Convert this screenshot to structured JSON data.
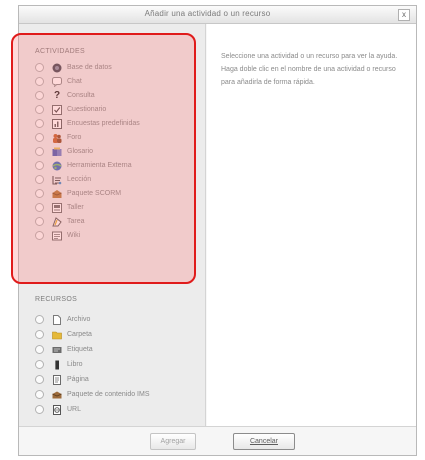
{
  "window": {
    "title": "Añadir una actividad o un recurso",
    "close": "x"
  },
  "help_text": "Seleccione una actividad o un recurso para ver la ayuda. Haga doble clic en el nombre de una actividad o recurso para añadirla de forma rápida.",
  "activities": {
    "heading": "ACTIVIDADES",
    "items": [
      {
        "label": "Base de datos",
        "icon": "database-icon",
        "color": "#444a55"
      },
      {
        "label": "Chat",
        "icon": "chat-icon",
        "color": "#8c8c8c"
      },
      {
        "label": "Consulta",
        "icon": "question-icon",
        "color": "#222222"
      },
      {
        "label": "Cuestionario",
        "icon": "quiz-icon",
        "color": "#6b6b6b"
      },
      {
        "label": "Encuestas predefinidas",
        "icon": "survey-icon",
        "color": "#5f5f5f"
      },
      {
        "label": "Foro",
        "icon": "forum-icon",
        "color": "#c2622d"
      },
      {
        "label": "Glosario",
        "icon": "glossary-icon",
        "color": "#4a5db6"
      },
      {
        "label": "Herramienta Externa",
        "icon": "external-tool-icon",
        "color": "#3b6cc1"
      },
      {
        "label": "Lección",
        "icon": "lesson-icon",
        "color": "#555555"
      },
      {
        "label": "Paquete SCORM",
        "icon": "scorm-icon",
        "color": "#b5793b"
      },
      {
        "label": "Taller",
        "icon": "workshop-icon",
        "color": "#6f6f6f"
      },
      {
        "label": "Tarea",
        "icon": "assignment-icon",
        "color": "#5a5a5a"
      },
      {
        "label": "Wiki",
        "icon": "wiki-icon",
        "color": "#6a6a6a"
      }
    ]
  },
  "resources": {
    "heading": "RECURSOS",
    "items": [
      {
        "label": "Archivo",
        "icon": "file-icon",
        "color": "#7a7a7a"
      },
      {
        "label": "Carpeta",
        "icon": "folder-icon",
        "color": "#e5b93a"
      },
      {
        "label": "Etiqueta",
        "icon": "label-icon",
        "color": "#6c6c6c"
      },
      {
        "label": "Libro",
        "icon": "book-icon",
        "color": "#333333"
      },
      {
        "label": "Página",
        "icon": "page-icon",
        "color": "#6a6a6a"
      },
      {
        "label": "Paquete de contenido IMS",
        "icon": "ims-icon",
        "color": "#9c6b3b"
      },
      {
        "label": "URL",
        "icon": "url-icon",
        "color": "#555555"
      }
    ]
  },
  "buttons": {
    "add": "Agregar",
    "cancel": "Cancelar"
  },
  "colors": {
    "highlight_border": "#e01b1b",
    "highlight_fill": "#ff7878"
  }
}
